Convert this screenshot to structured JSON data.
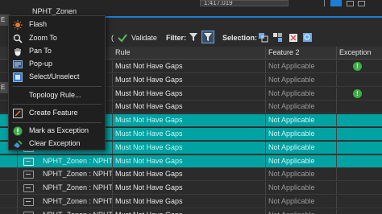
{
  "topbar": {
    "field_value": "1:417.019",
    "title": "NPHT_Zonen"
  },
  "toolbar": {
    "validate_label": "Validate",
    "filter_label": "Filter:",
    "selection_label": "Selection:",
    "partial_label": "("
  },
  "grid": {
    "columns": [
      "",
      "",
      "",
      "Rule",
      "Feature 2",
      "Exception"
    ],
    "rows": [
      {
        "name": "",
        "rule": "Must Not Have Gaps",
        "feature2": "Not Applicable",
        "exception": true,
        "selected": false
      },
      {
        "name": "",
        "rule": "Must Not Have Gaps",
        "feature2": "Not Applicable",
        "exception": false,
        "selected": false
      },
      {
        "name": "",
        "rule": "Must Not Have Gaps",
        "feature2": "Not Applicable",
        "exception": true,
        "selected": false
      },
      {
        "name": "",
        "rule": "Must Not Have Gaps",
        "feature2": "Not Applicable",
        "exception": false,
        "selected": false
      },
      {
        "name": "",
        "rule": "Must Not Have Gaps",
        "feature2": "Not Applicable",
        "exception": false,
        "selected": true
      },
      {
        "name": "",
        "rule": "Must Not Have Gaps",
        "feature2": "Not Applicable",
        "exception": false,
        "selected": true
      },
      {
        "name": "",
        "rule": "Must Not Have Gaps",
        "feature2": "Not Applicable",
        "exception": false,
        "selected": true
      },
      {
        "name": "NPHT_Zonen : NPHT...",
        "rule": "Must Not Have Gaps",
        "feature2": "Not Applicable",
        "exception": false,
        "selected": true
      },
      {
        "name": "NPHT_Zonen : NPHT...",
        "rule": "Must Not Have Gaps",
        "feature2": "Not Applicable",
        "exception": false,
        "selected": false
      },
      {
        "name": "NPHT_Zonen : NPHT...",
        "rule": "Must Not Have Gaps",
        "feature2": "Not Applicable",
        "exception": false,
        "selected": false
      },
      {
        "name": "NPHT_Zonen : NPHT...",
        "rule": "Must Not Have Gaps",
        "feature2": "Not Applicable",
        "exception": false,
        "selected": false
      },
      {
        "name": "NPHT_Zonen : NPHT...",
        "rule": "Must Not Have Gaps",
        "feature2": "Not Applicable",
        "exception": false,
        "selected": false
      }
    ]
  },
  "left_tabs": [
    "E",
    "E"
  ],
  "context_menu": {
    "items": [
      {
        "label": "Flash",
        "icon": "flash-icon"
      },
      {
        "label": "Zoom To",
        "icon": "zoom-to-icon"
      },
      {
        "label": "Pan To",
        "icon": "pan-hand-icon"
      },
      {
        "label": "Pop-up",
        "icon": "popup-icon"
      },
      {
        "label": "Select/Unselect",
        "icon": "select-icon"
      },
      {
        "label": "Topology Rule...",
        "icon": ""
      },
      {
        "label": "Create Feature",
        "icon": "create-feature-icon"
      },
      {
        "label": "Mark as Exception",
        "icon": "exception-icon"
      },
      {
        "label": "Clear Exception",
        "icon": "clear-exception-icon"
      }
    ]
  },
  "colors": {
    "selected_row": "#00a2a2",
    "exception_green": "#3fae49",
    "accent_blue": "#1c7ed6"
  }
}
